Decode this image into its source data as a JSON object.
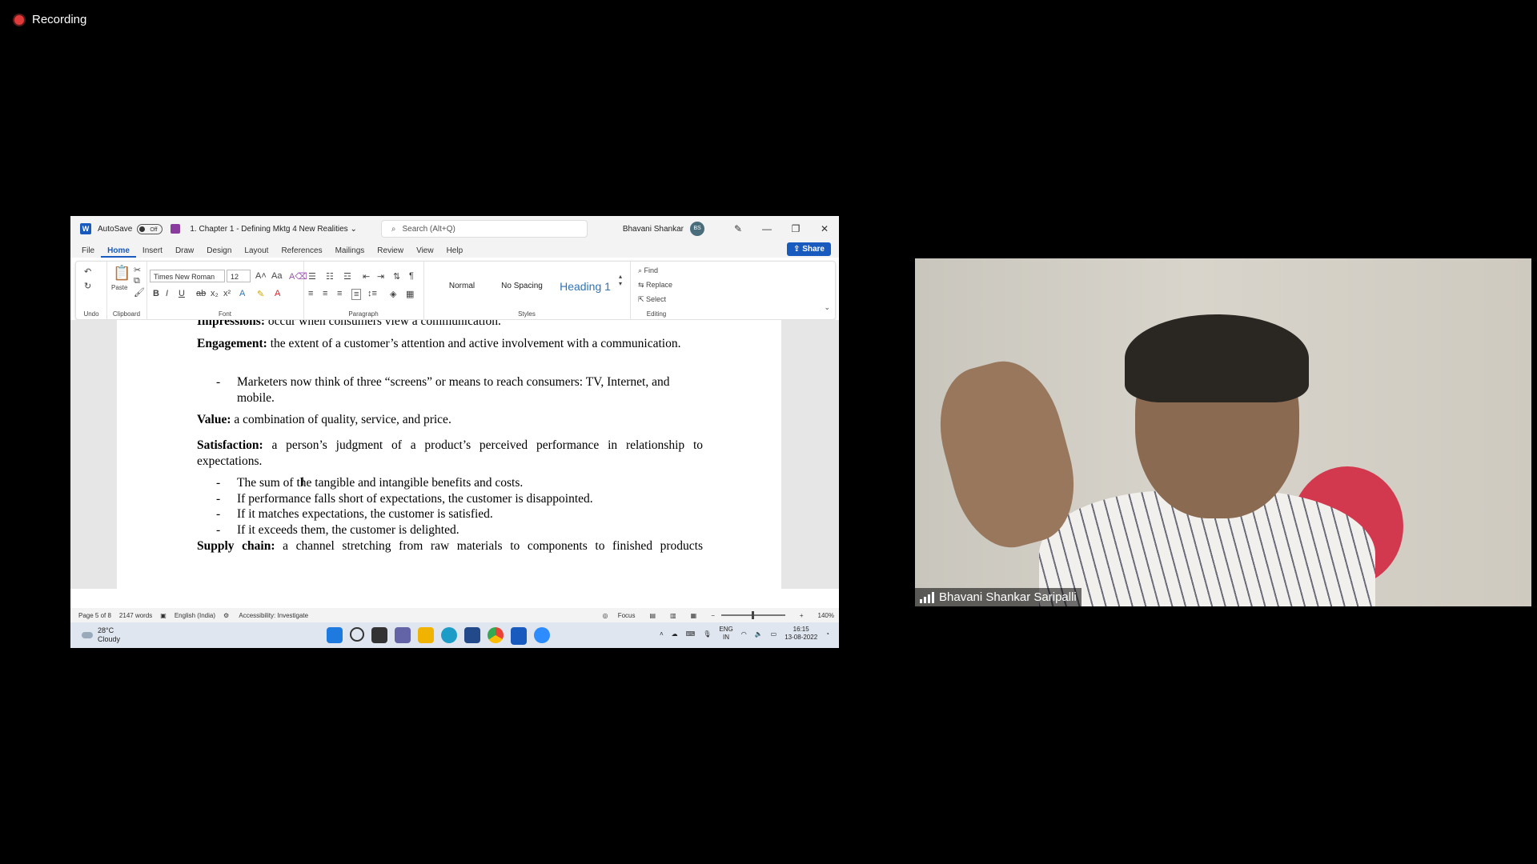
{
  "recording": {
    "label": "Recording"
  },
  "word": {
    "autosave_label": "AutoSave",
    "autosave_state": "Off",
    "doc_title": "1. Chapter 1 - Defining Mktg 4 New Realities",
    "search_placeholder": "Search (Alt+Q)",
    "user_name": "Bhavani Shankar",
    "user_initials": "BS",
    "menu": [
      "File",
      "Home",
      "Insert",
      "Draw",
      "Design",
      "Layout",
      "References",
      "Mailings",
      "Review",
      "View",
      "Help"
    ],
    "share_label": "Share",
    "ribbon": {
      "undo_label": "Undo",
      "clipboard_label": "Clipboard",
      "paste_label": "Paste",
      "font_label": "Font",
      "font_name": "Times New Roman",
      "font_size": "12",
      "paragraph_label": "Paragraph",
      "styles_label": "Styles",
      "styles": [
        "Normal",
        "No Spacing",
        "Heading 1"
      ],
      "editing_label": "Editing",
      "find_label": "Find",
      "replace_label": "Replace",
      "select_label": "Select"
    },
    "document": {
      "p0_bold": "Impressions:",
      "p0_text": " occur when consumers view a communication.",
      "p1_bold": "Engagement:",
      "p1_text": " the extent of a customer’s attention and active involvement with a communication.",
      "b1": "Marketers now think of three “screens” or means to reach consumers: TV, Internet, and mobile.",
      "p2_bold": "Value:",
      "p2_text": " a combination of quality, service, and price.",
      "p3_bold": "Satisfaction:",
      "p3_text": " a person’s judgment of a product’s perceived performance in relationship to expectations.",
      "bullets": [
        "The sum of the tangible and intangible benefits and costs.",
        "If performance falls short of expectations, the customer is disappointed.",
        "If it matches expectations, the customer is satisfied.",
        "If it exceeds them, the customer is delighted."
      ],
      "p4_bold": "Supply chain:",
      "p4_text": " a channel stretching from raw materials to components to finished products"
    },
    "status": {
      "page": "Page 5 of 8",
      "words": "2147 words",
      "language": "English (India)",
      "accessibility": "Accessibility: Investigate",
      "focus": "Focus",
      "zoom": "140%"
    }
  },
  "taskbar": {
    "temperature": "28°C",
    "weather": "Cloudy",
    "lang_top": "ENG",
    "lang_bottom": "IN",
    "time": "16:15",
    "date": "13-08-2022"
  },
  "video": {
    "participant_name": "Bhavani Shankar Saripalli"
  }
}
